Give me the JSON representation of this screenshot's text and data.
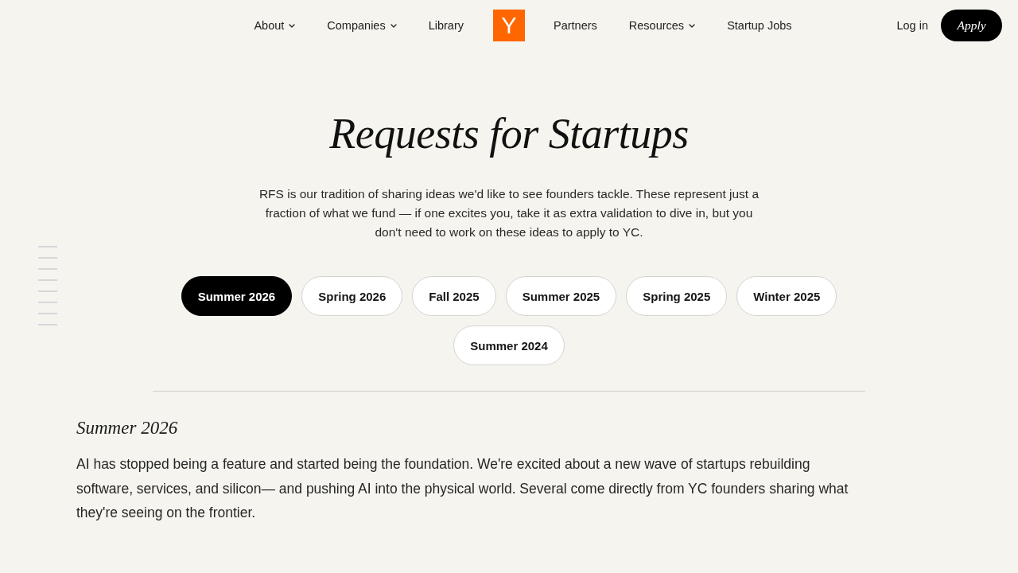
{
  "nav": {
    "left_links": [
      {
        "label": "About",
        "kind": "menu"
      },
      {
        "label": "Companies",
        "kind": "menu"
      },
      {
        "label": "Library",
        "kind": "link"
      }
    ],
    "logo": "Y",
    "right_links": [
      {
        "label": "Partners",
        "kind": "link"
      },
      {
        "label": "Resources",
        "kind": "menu"
      },
      {
        "label": "Startup Jobs",
        "kind": "link"
      }
    ],
    "login": "Log in",
    "apply": "Apply"
  },
  "hero": {
    "title": "Requests for Startups",
    "intro": "RFS is our tradition of sharing ideas we'd like to see founders tackle. These represent just a fraction of what we fund — if one excites you, take it as extra validation to dive in, but you don't need to work on these ideas to apply to YC."
  },
  "batches": [
    {
      "label": "Summer 2026",
      "selected": true
    },
    {
      "label": "Spring 2026",
      "selected": false
    },
    {
      "label": "Fall 2025",
      "selected": false
    },
    {
      "label": "Summer 2025",
      "selected": false
    },
    {
      "label": "Spring 2025",
      "selected": false
    },
    {
      "label": "Winter 2025",
      "selected": false
    },
    {
      "label": "Summer 2024",
      "selected": false
    }
  ],
  "section": {
    "heading": "Summer 2026",
    "text": "AI has stopped being a feature and started being the foundation. We're excited about a new wave of startups rebuilding software, services, and silicon— and pushing AI into the physical world. Several come directly from YC founders sharing what they're seeing on the frontier."
  }
}
